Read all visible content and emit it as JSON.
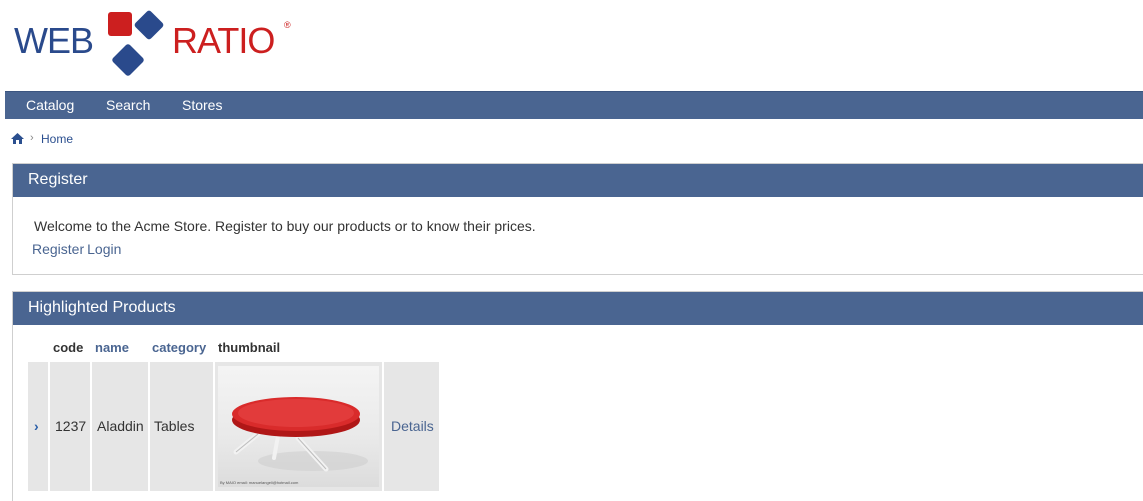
{
  "logo": {
    "left": "WEB",
    "right": "RATIO",
    "reg": "®"
  },
  "nav": {
    "items": [
      "Catalog",
      "Search",
      "Stores"
    ]
  },
  "breadcrumb": {
    "separator": "›",
    "home": "Home"
  },
  "register": {
    "title": "Register",
    "welcome": "Welcome to the Acme Store. Register to buy our products or to know their prices.",
    "register_link": "Register",
    "login_link": "Login"
  },
  "highlighted": {
    "title": "Highlighted Products",
    "columns": {
      "code": "code",
      "name": "name",
      "category": "category",
      "thumbnail": "thumbnail"
    },
    "rows": [
      {
        "code": "1237",
        "name": "Aladdin",
        "category": "Tables",
        "thumbnail_caption": "By MAIO email: manuelangeli@hotmail.com",
        "details": "Details"
      }
    ],
    "row_arrow": "›"
  },
  "colors": {
    "nav_bg": "#4a6591",
    "logo_blue": "#2a4a8c",
    "logo_red": "#cc1f1f",
    "link": "#4a6591",
    "row_bg": "#e6e6e6"
  }
}
